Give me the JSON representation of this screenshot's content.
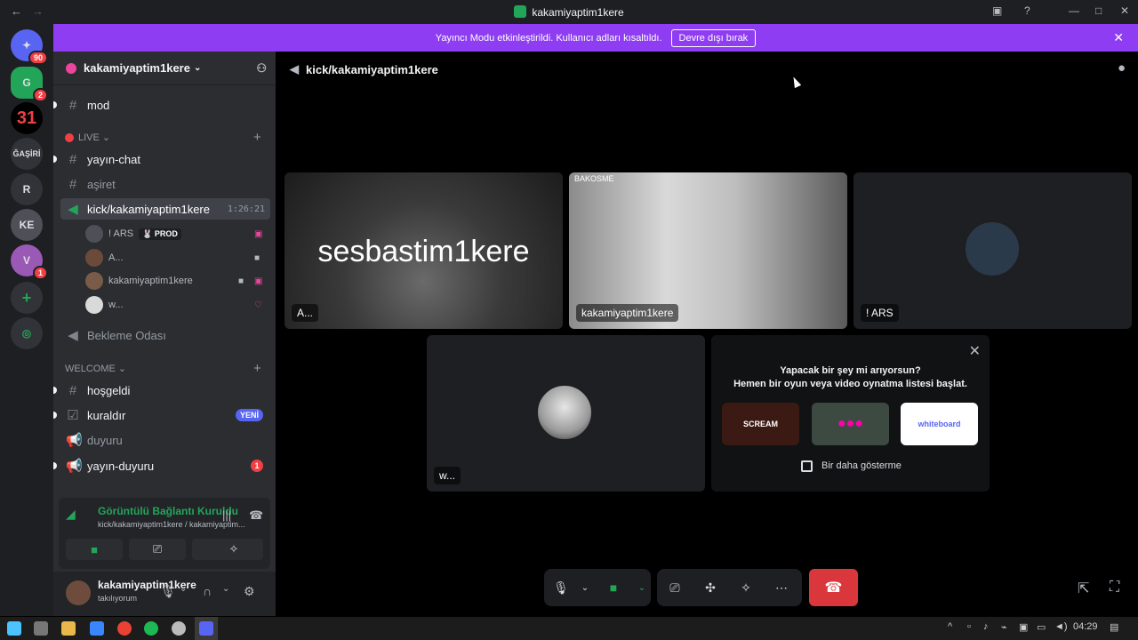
{
  "window": {
    "title": "kakamiyaptim1kere",
    "back": "←",
    "forward": "→"
  },
  "guilds": {
    "home_badge": "90",
    "g2_badge": "2",
    "g3_label": "31",
    "g4_label": "ĞAŞİRİ",
    "g5_label": "R",
    "g6_label": "KE",
    "g7_badge": "1"
  },
  "banner": {
    "text": "Yayıncı Modu etkinleştirildi. Kullanıcı adları kısaltıldı.",
    "button": "Devre dışı bırak"
  },
  "server": {
    "name": "kakamiyaptim1kere"
  },
  "channels": {
    "mod": "mod",
    "live_category": "LIVE",
    "yayin_chat": "yayın-chat",
    "asiret": "aşiret",
    "voice_active": "kick/kakamiyaptim1kere",
    "voice_duration": "1:26:21",
    "waiting_room": "Bekleme Odası",
    "welcome_category": "WELCOME",
    "hosgeldi": "hoşgeldi",
    "kuraldir": "kuraldır",
    "kuraldir_badge": "YENİ",
    "duyuru": "duyuru",
    "yayin_duyuru": "yayın-duyuru",
    "yayin_duyuru_badge": "1"
  },
  "voice_users": [
    {
      "name": "! ARS",
      "tag": "🐰 PROD"
    },
    {
      "name": "A..."
    },
    {
      "name": "kakamiyaptim1kere"
    },
    {
      "name": "w..."
    }
  ],
  "voice_panel": {
    "status": "Görüntülü Bağlantı Kuruldu",
    "location": "kick/kakamiyaptim1kere / kakamiyaptim..."
  },
  "user": {
    "name": "kakamiyaptim1kere",
    "status": "takılıyorum"
  },
  "call": {
    "header": "kick/kakamiyaptim1kere",
    "tiles": [
      {
        "name": "A...",
        "overlay": "sesbastim1kere"
      },
      {
        "name": "kakamiyaptim1kere",
        "watermark": "BAKOSME"
      },
      {
        "name": "! ARS"
      },
      {
        "name": "w..."
      }
    ]
  },
  "activity": {
    "title_line1": "Yapacak bir şey mi arıyorsun?",
    "title_line2": "Hemen bir oyun veya video oynatma listesi başlat.",
    "cards": [
      "SCREAM",
      "",
      "whiteboard"
    ],
    "dont_show": "Bir daha gösterme"
  },
  "taskbar": {
    "clock": "04:29"
  },
  "colors": {
    "brand_purple": "#8e3df2",
    "online_green": "#23a559",
    "danger_red": "#da373c"
  }
}
